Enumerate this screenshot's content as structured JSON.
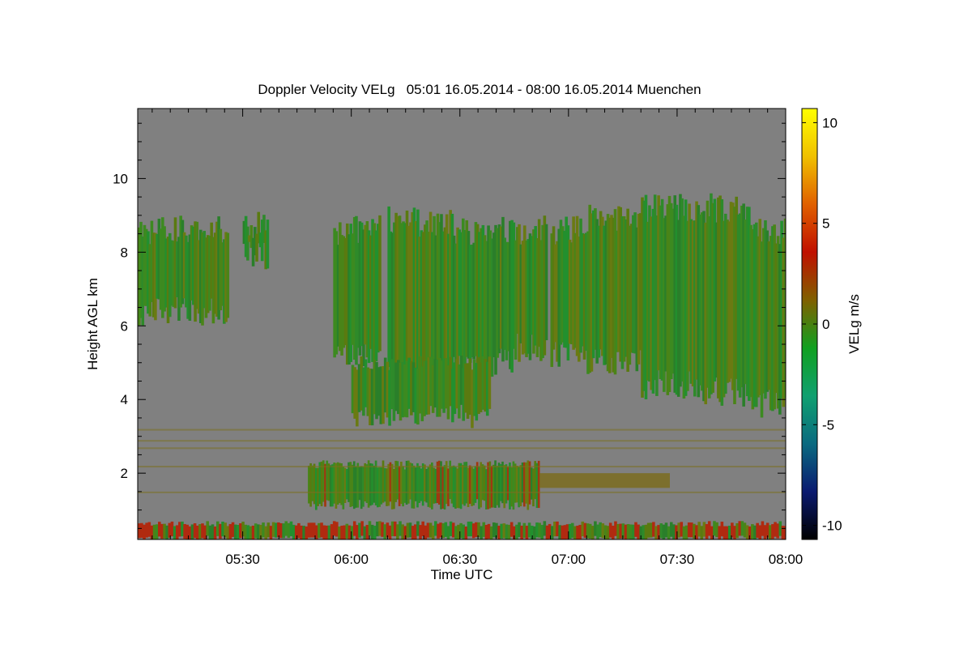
{
  "chart_data": {
    "type": "heatmap",
    "title": "Doppler Velocity VELg   05:01 16.05.2014 - 08:00 16.05.2014 Muenchen",
    "xlabel": "Time UTC",
    "ylabel": "Height AGL km",
    "colorbar_label": "VELg m/s",
    "x_start": "05:01",
    "x_end": "08:00",
    "xlim_minutes_utc": [
      301,
      480
    ],
    "ylim_km": [
      0.2,
      11.9
    ],
    "x_ticks": [
      {
        "minute": 330,
        "label": "05:30"
      },
      {
        "minute": 360,
        "label": "06:00"
      },
      {
        "minute": 390,
        "label": "06:30"
      },
      {
        "minute": 420,
        "label": "07:00"
      },
      {
        "minute": 450,
        "label": "07:30"
      },
      {
        "minute": 480,
        "label": "08:00"
      }
    ],
    "y_ticks": [
      {
        "value": 2,
        "label": "2"
      },
      {
        "value": 4,
        "label": "4"
      },
      {
        "value": 6,
        "label": "6"
      },
      {
        "value": 8,
        "label": "8"
      },
      {
        "value": 10,
        "label": "10"
      }
    ],
    "colorbar": {
      "range": [
        -10.7,
        10.7
      ],
      "ticks": [
        {
          "value": 10,
          "label": "10"
        },
        {
          "value": 5,
          "label": "5"
        },
        {
          "value": 0,
          "label": "0"
        },
        {
          "value": -5,
          "label": "-5"
        },
        {
          "value": -10,
          "label": "-10"
        }
      ],
      "colors": [
        "#000000",
        "#0a1a70",
        "#0a6a80",
        "#10a070",
        "#10a020",
        "#806000",
        "#c01000",
        "#e06000",
        "#f0c000",
        "#ffff00"
      ]
    },
    "background_color": "#808080",
    "cloud_regions": [
      {
        "name": "upper-cloud-band",
        "x_minutes": [
          301,
          480
        ],
        "height_km": [
          3.5,
          9.6
        ],
        "velocity_ms": [
          -2,
          1
        ]
      },
      {
        "name": "lower-cloud-band",
        "x_minutes": [
          348,
          411
        ],
        "height_km": [
          1.0,
          2.3
        ],
        "velocity_ms": [
          -2,
          2
        ]
      },
      {
        "name": "near-surface-layer",
        "x_minutes": [
          301,
          480
        ],
        "height_km": [
          0.2,
          0.6
        ],
        "velocity_ms": [
          -1,
          3
        ]
      }
    ],
    "grid": false,
    "legend": "colorbar-right"
  }
}
